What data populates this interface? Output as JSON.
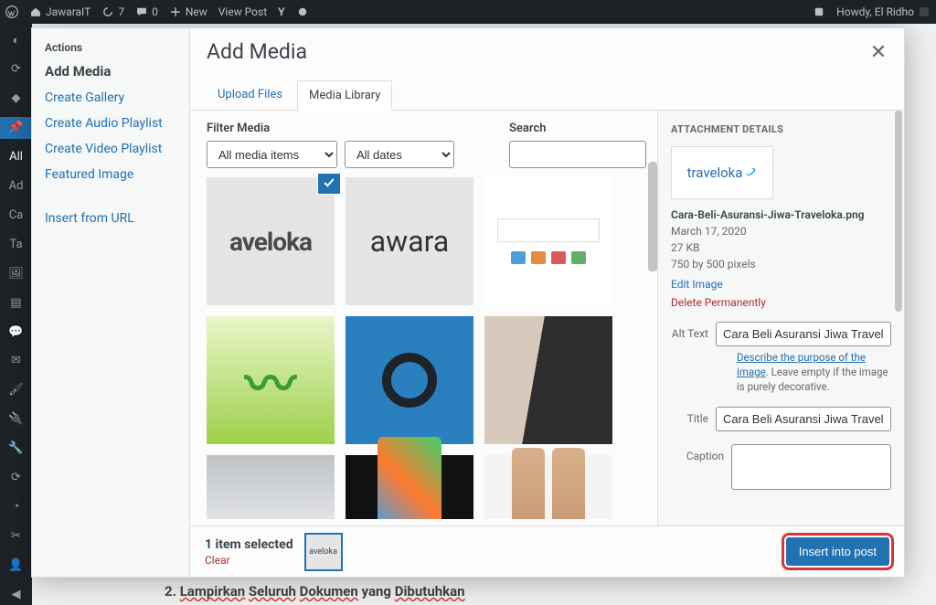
{
  "adminbar": {
    "site_name": "JawaraIT",
    "updates_count": "7",
    "comments_count": "0",
    "new_label": "New",
    "view_post_label": "View Post",
    "howdy": "Howdy, El Ridho"
  },
  "sidebar_bg": {
    "items": [
      "All",
      "Ad",
      "Ca",
      "Ta"
    ]
  },
  "modal": {
    "actions_heading": "Actions",
    "current_action": "Add Media",
    "actions": {
      "add_media": "Add Media",
      "create_gallery": "Create Gallery",
      "create_audio": "Create Audio Playlist",
      "create_video": "Create Video Playlist",
      "featured_image": "Featured Image",
      "insert_url": "Insert from URL"
    },
    "title": "Add Media",
    "tabs": {
      "upload": "Upload Files",
      "library": "Media Library"
    },
    "filter_label": "Filter Media",
    "filter_all": "All media items",
    "filter_dates": "All dates",
    "search_label": "Search",
    "details_heading": "ATTACHMENT DETAILS",
    "preview_text": "traveloka",
    "filename": "Cara-Beli-Asuransi-Jiwa-Traveloka.png",
    "date": "March 17, 2020",
    "size": "27 KB",
    "dimensions": "750 by 500 pixels",
    "edit_image": "Edit Image",
    "delete": "Delete Permanently",
    "alt_label": "Alt Text",
    "alt_value": "Cara Beli Asuransi Jiwa Traveloka",
    "alt_help_link": "Describe the purpose of the image",
    "alt_help_rest": ". Leave empty if the image is purely decorative.",
    "title_fld_label": "Title",
    "title_fld_value": "Cara Beli Asuransi Jiwa Traveloka",
    "caption_label": "Caption",
    "selected_count": "1 item selected",
    "clear": "Clear",
    "insert_btn": "Insert into post"
  },
  "backdrop": {
    "text_prefix": "2. ",
    "word1": "Lampirkan",
    "word2": "Seluruh",
    "word3": "Dokumen",
    "mid": " yang ",
    "word4": "Dibutuhkan"
  }
}
